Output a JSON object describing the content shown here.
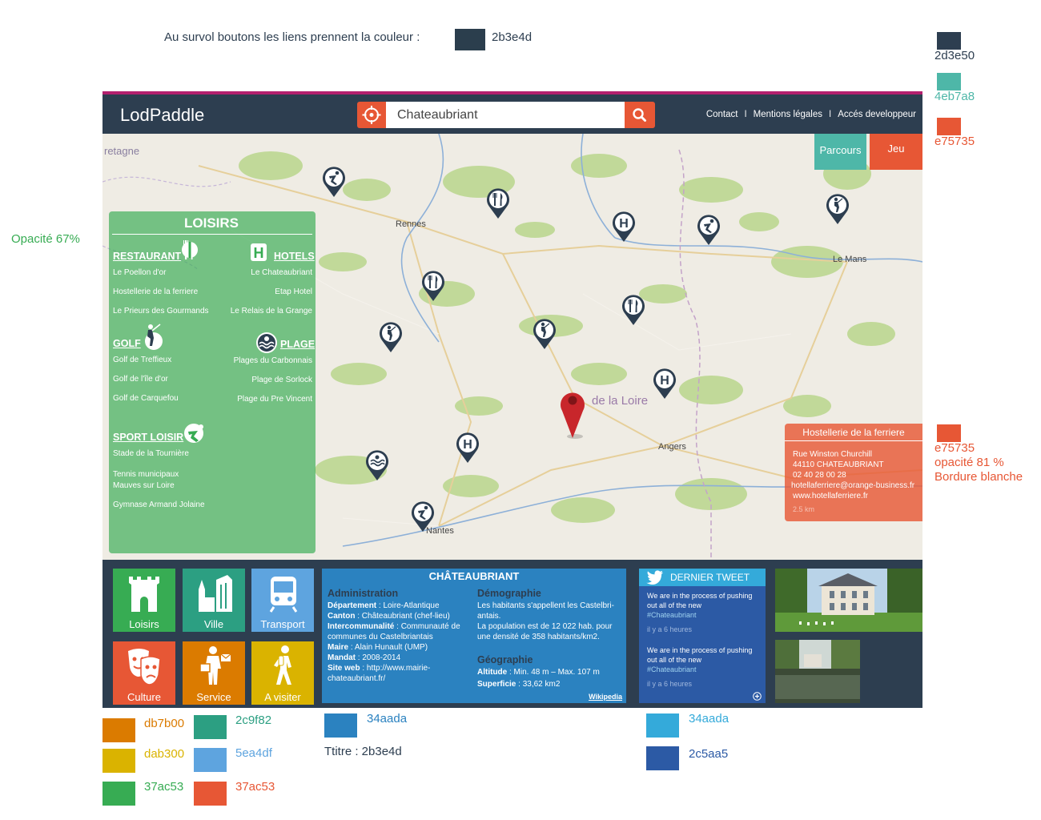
{
  "annotations": {
    "hover_note": "Au survol boutons les liens prennent la couleur :",
    "hover_color": "2b3e4d",
    "opacity_note": "Opacité 67%",
    "palette_right": [
      {
        "label": "2d3e50",
        "color": "#2d3e50"
      },
      {
        "label": "4eb7a8",
        "color": "#4eb7a8"
      },
      {
        "label": "e75735",
        "color": "#e75735"
      }
    ],
    "popup_color": {
      "label": "e75735",
      "opacity": "opacité 81 %",
      "border": "Bordure blanche",
      "color": "#e75735"
    },
    "bottom_swatches": [
      {
        "label": "db7b00",
        "color": "#db7b00"
      },
      {
        "label": "2c9f82",
        "color": "#2c9f82"
      },
      {
        "label": "dab300",
        "color": "#dab300"
      },
      {
        "label": "5ea4df",
        "color": "#5ea4df"
      },
      {
        "label": "37ac53",
        "color": "#37ac53"
      },
      {
        "label": "37ac53",
        "color": "#e75735"
      }
    ],
    "info_swatch": {
      "label": "34aada",
      "color": "#2b82c0"
    },
    "title_note": "Ttitre : 2b3e4d",
    "twitter_swatches": [
      {
        "label": "34aada",
        "color": "#34aada"
      },
      {
        "label": "2c5aa5",
        "color": "#2c5aa5"
      }
    ]
  },
  "header": {
    "logo": "LodPaddle",
    "search_value": "Chateaubriant",
    "nav": [
      "Contact",
      "Mentions légales",
      "Accés developpeur"
    ],
    "nav_sep": "I"
  },
  "map": {
    "tabs": [
      "Parcours",
      "Jeu"
    ],
    "labels": {
      "bretagne": "retagne",
      "rennes": "Rennes",
      "lemans": "Le Mans",
      "loire": "de la Loire",
      "angers": "Angers",
      "nantes": "Nantes"
    }
  },
  "loisirs": {
    "title": "LOISIRS",
    "restaurant": {
      "label": "RESTAURANT",
      "items": [
        "Le Poellon d'or",
        "Hostellerie de la ferriere",
        "Le Prieurs des Gourmands"
      ]
    },
    "hotels": {
      "label": "HOTELS",
      "items": [
        "Le Chateaubriant",
        "Etap Hotel",
        "Le Relais de la Grange"
      ]
    },
    "golf": {
      "label": "GOLF",
      "items": [
        "Golf de Treffieux",
        "Golf de l'île d'or",
        "Golf de Carquefou"
      ]
    },
    "plage": {
      "label": "PLAGE",
      "items": [
        "Plages du Carbonnais",
        "Plage de Sorlock",
        "Plage du Pre Vincent"
      ]
    },
    "sport": {
      "label": "SPORT LOISIR",
      "items": [
        "Stade de la Tournière",
        "Tennis municipaux",
        "Mauves sur Loire",
        "Gymnase Armand Jolaine"
      ]
    }
  },
  "popup": {
    "title": "Hostellerie de la ferriere",
    "lines": [
      "Rue Winston Churchill",
      "44110 CHATEAUBRIANT",
      "02 40 28 00 28",
      "hotellaferriere@orange-business.fr",
      "www.hotellaferriere.fr"
    ],
    "distance": "2.5 km"
  },
  "tiles": [
    {
      "label": "Loisirs",
      "color": "#37ac53",
      "icon": "castle-icon"
    },
    {
      "label": "Ville",
      "color": "#2c9f82",
      "icon": "city-icon"
    },
    {
      "label": "Transport",
      "color": "#5ea4df",
      "icon": "train-icon"
    },
    {
      "label": "Culture",
      "color": "#e75735",
      "icon": "theater-masks-icon"
    },
    {
      "label": "Service",
      "color": "#db7b00",
      "icon": "postman-icon"
    },
    {
      "label": "A visiter",
      "color": "#dab300",
      "icon": "walker-icon"
    }
  ],
  "info": {
    "title": "CHÂTEAUBRIANT",
    "admin_head": "Administration",
    "admin": [
      {
        "k": "Département",
        "v": " : Loire-Atlantique"
      },
      {
        "k": "Canton",
        "v": " : Châteaubriant (chef-lieu)"
      },
      {
        "k": "Intercommunalité",
        "v": " : Communauté de communes du Castelbriantais"
      },
      {
        "k": "Maire",
        "v": " : Alain Hunault (UMP)"
      },
      {
        "k": "Mandat",
        "v": " : 2008-2014"
      },
      {
        "k": "Site web",
        "v": " : http://www.mairie-chateaubriant.fr/"
      }
    ],
    "demo_head": "Démographie",
    "demo_lines": [
      "Les habitants s'appellent les Castelbri-",
      "antais.",
      "La population est de 12 022 hab. pour",
      "une densité de 358 habitants/km2."
    ],
    "geo_head": "Géographie",
    "geo": [
      {
        "k": "Altitude",
        "v": " : Min. 48 m – Max. 107 m"
      },
      {
        "k": "Superficie",
        "v": " : 33,62 km2"
      }
    ],
    "wiki": "Wikipedia"
  },
  "twitter": {
    "title": "DERNIER TWEET",
    "tweets": [
      {
        "l1": "We are in the process of pushing",
        "l2": "out all of the new",
        "tag": "#Chateaubriant",
        "ago": "il y a 6 heures"
      },
      {
        "l1": "We are in the process of pushing",
        "l2": "out all of the new",
        "tag": "#Chateaubriant",
        "ago": "il y a 6 heures"
      }
    ]
  }
}
